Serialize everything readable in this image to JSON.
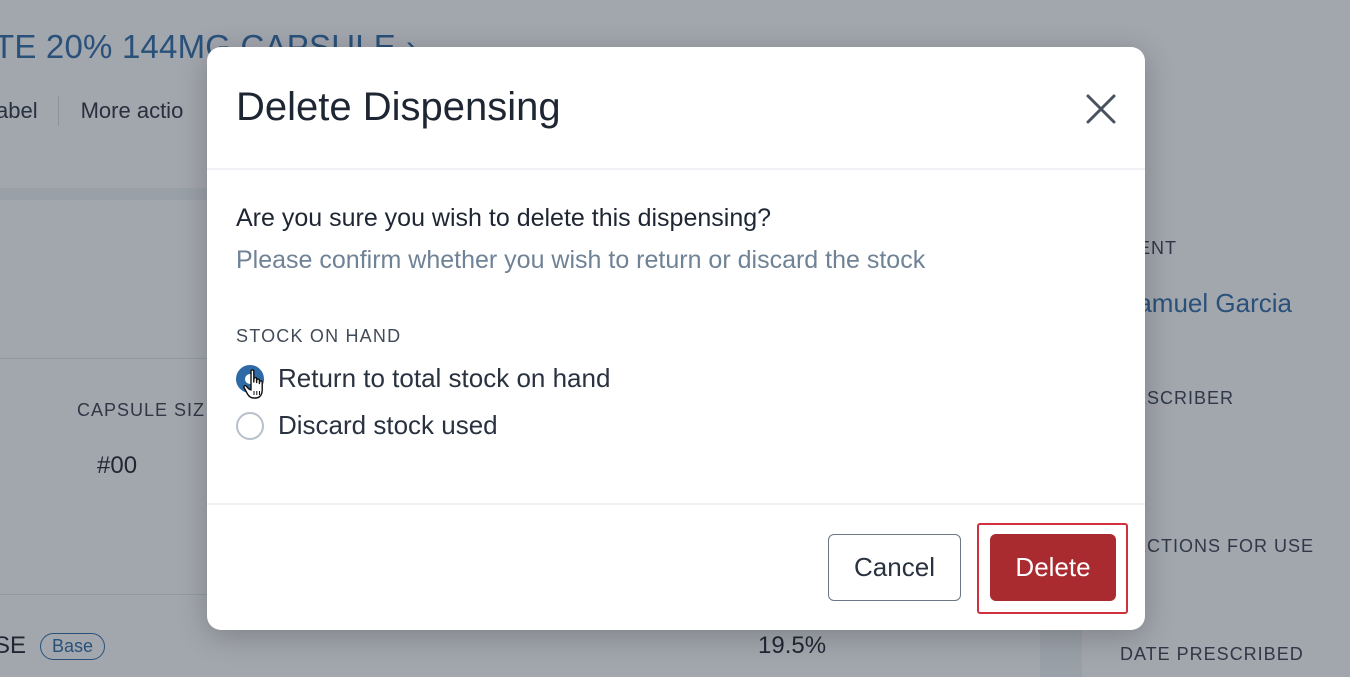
{
  "background": {
    "product_title": "TE 20% 144MG CAPSULE",
    "product_title_chevron": "›",
    "header_actions": [
      "abel",
      "More actio"
    ],
    "fields": {
      "capsule_size_label": "CAPSULE SIZ",
      "capsule_size_value": "#00"
    },
    "ingredient": {
      "name": "SE",
      "badge": "Base",
      "percent": "19.5%"
    },
    "sidebar": {
      "patient_label": "TIENT",
      "patient_name": "Samuel Garcia",
      "prescriber_label": "RESCRIBER",
      "prescriber_value": "-",
      "directions_label": "RECTIONS FOR USE",
      "date_label": "DATE PRESCRIBED"
    }
  },
  "modal": {
    "title": "Delete Dispensing",
    "close_icon": "close-icon",
    "question": "Are you sure you wish to delete this dispensing?",
    "hint": "Please confirm whether you wish to return or discard the stock",
    "section_label": "STOCK ON HAND",
    "options": [
      {
        "label": "Return to total stock on hand",
        "checked": true
      },
      {
        "label": "Discard stock used",
        "checked": false
      }
    ],
    "cancel_label": "Cancel",
    "delete_label": "Delete"
  },
  "colors": {
    "accent": "#2e6ba6",
    "danger": "#a92a2f",
    "focus_ring": "#d1303e",
    "overlay": "rgba(33,43,60,0.42)"
  }
}
